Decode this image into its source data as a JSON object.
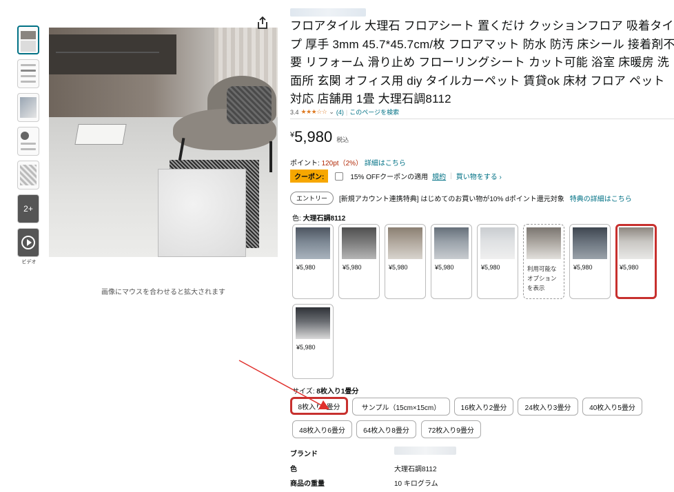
{
  "product": {
    "title": "フロアタイル 大理石 フロアシート 置くだけ クッションフロア 吸着タイプ 厚手 3mm 45.7*45.7cm/枚 フロアマット 防水 防汚 床シール 接着剤不要 リフォーム 滑り止め フローリングシート カット可能 浴室 床暖房 洗面所 玄関 オフィス用 diy タイルカーペット 賃貸ok 床材 フロア ペット対応 店舗用 1畳 大理石調8112",
    "rating_value": "3.4",
    "rating_stars": "★★★☆☆",
    "rating_count": "(4)",
    "search_page_link": "このページを検索",
    "price_yen": "¥",
    "price_amount": "5,980",
    "price_tax": "税込",
    "points_prefix": "ポイント:",
    "points_value": "120pt（2%）",
    "points_detail_link": "詳細はこちら",
    "coupon_badge": "クーポン:",
    "coupon_text": "15% OFFクーポンの適用",
    "coupon_terms_link": "規約",
    "coupon_shop_link": "買い物をする ›",
    "entry_button": "エントリー",
    "entry_text": "[新規アカウント連携特典] はじめてのお買い物が10% dポイント還元対象",
    "entry_link": "特典の詳細はこちら"
  },
  "gallery": {
    "zoom_hint": "画像にマウスを合わせると拡大されます",
    "more_label": "2+",
    "video_label": "ビデオ"
  },
  "color": {
    "label_prefix": "色:",
    "selected_value": "大理石調8112",
    "options": [
      {
        "price": "¥5,980"
      },
      {
        "price": "¥5,980"
      },
      {
        "price": "¥5,980"
      },
      {
        "price": "¥5,980"
      },
      {
        "price": "¥5,980"
      },
      {
        "text": "利用可能なオプションを表示"
      },
      {
        "price": "¥5,980"
      },
      {
        "price": "¥5,980"
      },
      {
        "price": "¥5,980"
      }
    ]
  },
  "size": {
    "label_prefix": "サイズ:",
    "selected_value": "8枚入り1畳分",
    "options": [
      "8枚入り1畳分",
      "サンプル（15cm×15cm）",
      "16枚入り2畳分",
      "24枚入り3畳分",
      "40枚入り5畳分",
      "48枚入り6畳分",
      "64枚入り8畳分",
      "72枚入り9畳分"
    ]
  },
  "specs": [
    {
      "key": "ブランド",
      "value": ""
    },
    {
      "key": "色",
      "value": "大理石調8112"
    },
    {
      "key": "商品の重量",
      "value": "10 キログラム"
    }
  ],
  "colors": {
    "accent_link": "#007185",
    "price_red": "#b12704",
    "coupon": "#f7a700",
    "annotation_red": "#c7302e",
    "star": "#de7921"
  }
}
